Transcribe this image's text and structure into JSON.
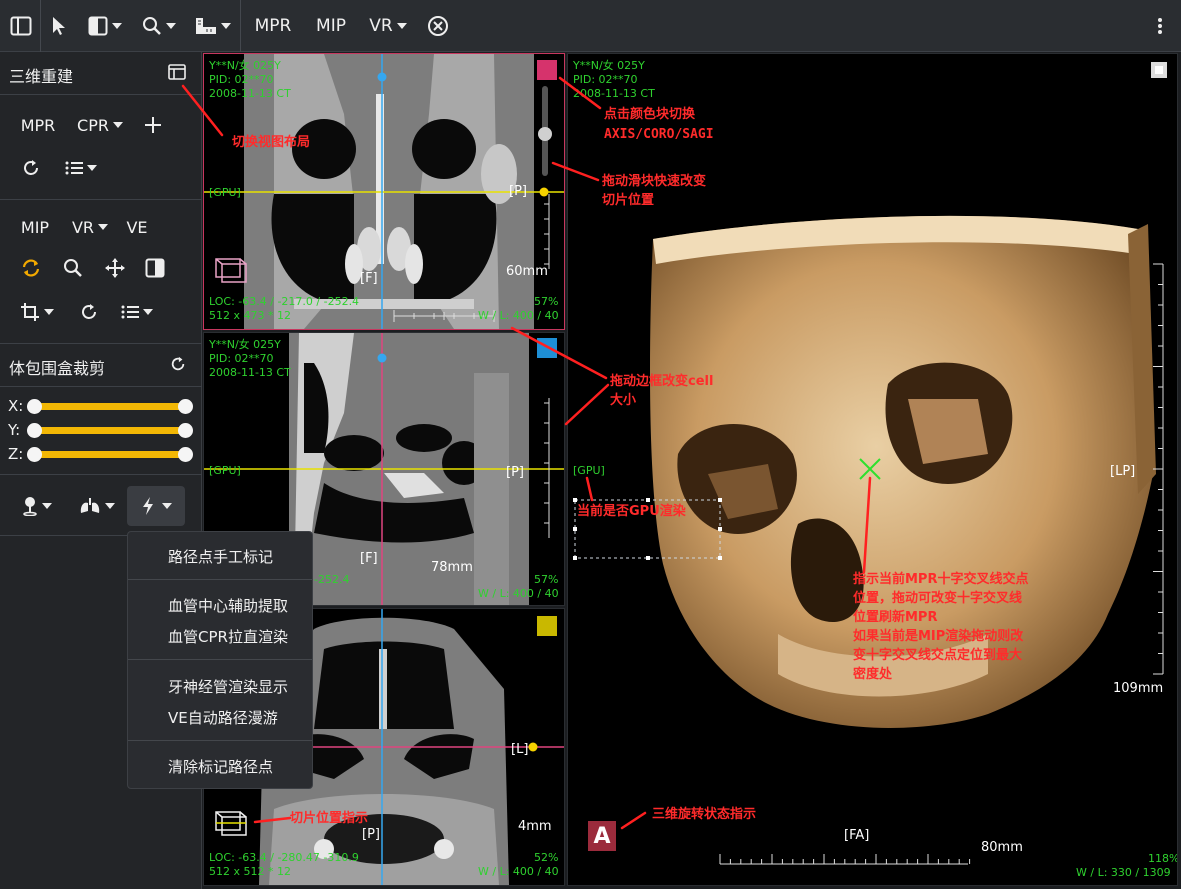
{
  "toolbar": {
    "mpr_label": "MPR",
    "mip_label": "MIP",
    "vr_label": "VR"
  },
  "sidebar": {
    "panel_title": "三维重建",
    "row1": {
      "mpr": "MPR",
      "cpr": "CPR"
    },
    "row2": {
      "mip": "MIP",
      "vr": "VR",
      "ve": "VE"
    },
    "crop_title": "体包围盒裁剪",
    "sliders": [
      {
        "label": "X:",
        "min": 0.0,
        "max": 1.0
      },
      {
        "label": "Y:",
        "min": 0.0,
        "max": 1.0
      },
      {
        "label": "Z:",
        "min": 0.0,
        "max": 1.0
      }
    ]
  },
  "menu": {
    "items": [
      "路径点手工标记",
      "血管中心辅助提取",
      "血管CPR拉直渲染",
      "牙神经管渲染显示",
      "VE自动路径漫游",
      "清除标记路径点"
    ]
  },
  "viewports": {
    "coronal": {
      "name": "Y**N/女 025Y",
      "pid": "PID: 02**70",
      "date": "2008-11-13 CT",
      "gpu": "[GPU]",
      "orient_right": "[P]",
      "orient_bottom": "[F]",
      "scale": "60mm",
      "loc": "LOC: -63.4 / -217.0 / -252.4",
      "size": "512 x 473 * 12",
      "zoom": "57%",
      "wl": "W / L:  400 / 40",
      "color": "#d6336c"
    },
    "sagittal": {
      "name": "Y**N/女 025Y",
      "pid": "PID: 02**70",
      "date": "2008-11-13 CT",
      "gpu": "[GPU]",
      "orient_right": "[P]",
      "orient_bottom": "[F]",
      "scale": "78mm",
      "loc": "-252.4",
      "zoom": "57%",
      "wl": "W / L:  400 / 40",
      "color": "#1e8fd6"
    },
    "axial": {
      "orient_right": "[L]",
      "orient_bottom": "[P]",
      "scale": "4mm",
      "loc": "LOC: -63.4 / -280.47 -310.9",
      "size": "512 x 512 * 12",
      "zoom": "52%",
      "wl": "W / L:  400 / 40",
      "color": "#c9b800"
    },
    "volume": {
      "name": "Y**N/女 025Y",
      "pid": "PID: 02**70",
      "date": "2008-11-13 CT",
      "gpu": "[GPU]",
      "orient_right": "[LP]",
      "orient_bottom": "[FA]",
      "scale_v": "109mm",
      "scale_h": "80mm",
      "zoom": "118%",
      "wl": "W / L:  330 / 1309",
      "rotate_badge": "A"
    }
  },
  "annotations": {
    "layout": "切换视图布局",
    "color_block_1": "点击颜色块切换",
    "color_block_2": "AXIS/CORO/SAGI",
    "slider_1": "拖动滑块快速改变",
    "slider_2": "切片位置",
    "border_1": "拖动边框改变cell",
    "border_2": "大小",
    "gpu": "当前是否GPU渲染",
    "cross_1": "指示当前MPR十字交叉线交点",
    "cross_2": "位置，拖动可改变十字交叉线",
    "cross_3": "位置刷新MPR",
    "cross_4": "如果当前是MIP渲染拖动则改",
    "cross_5": "变十字交叉线交点定位到最大",
    "cross_6": "密度处",
    "slice_pos": "切片位置指示",
    "rotate": "三维旋转状态指示"
  }
}
